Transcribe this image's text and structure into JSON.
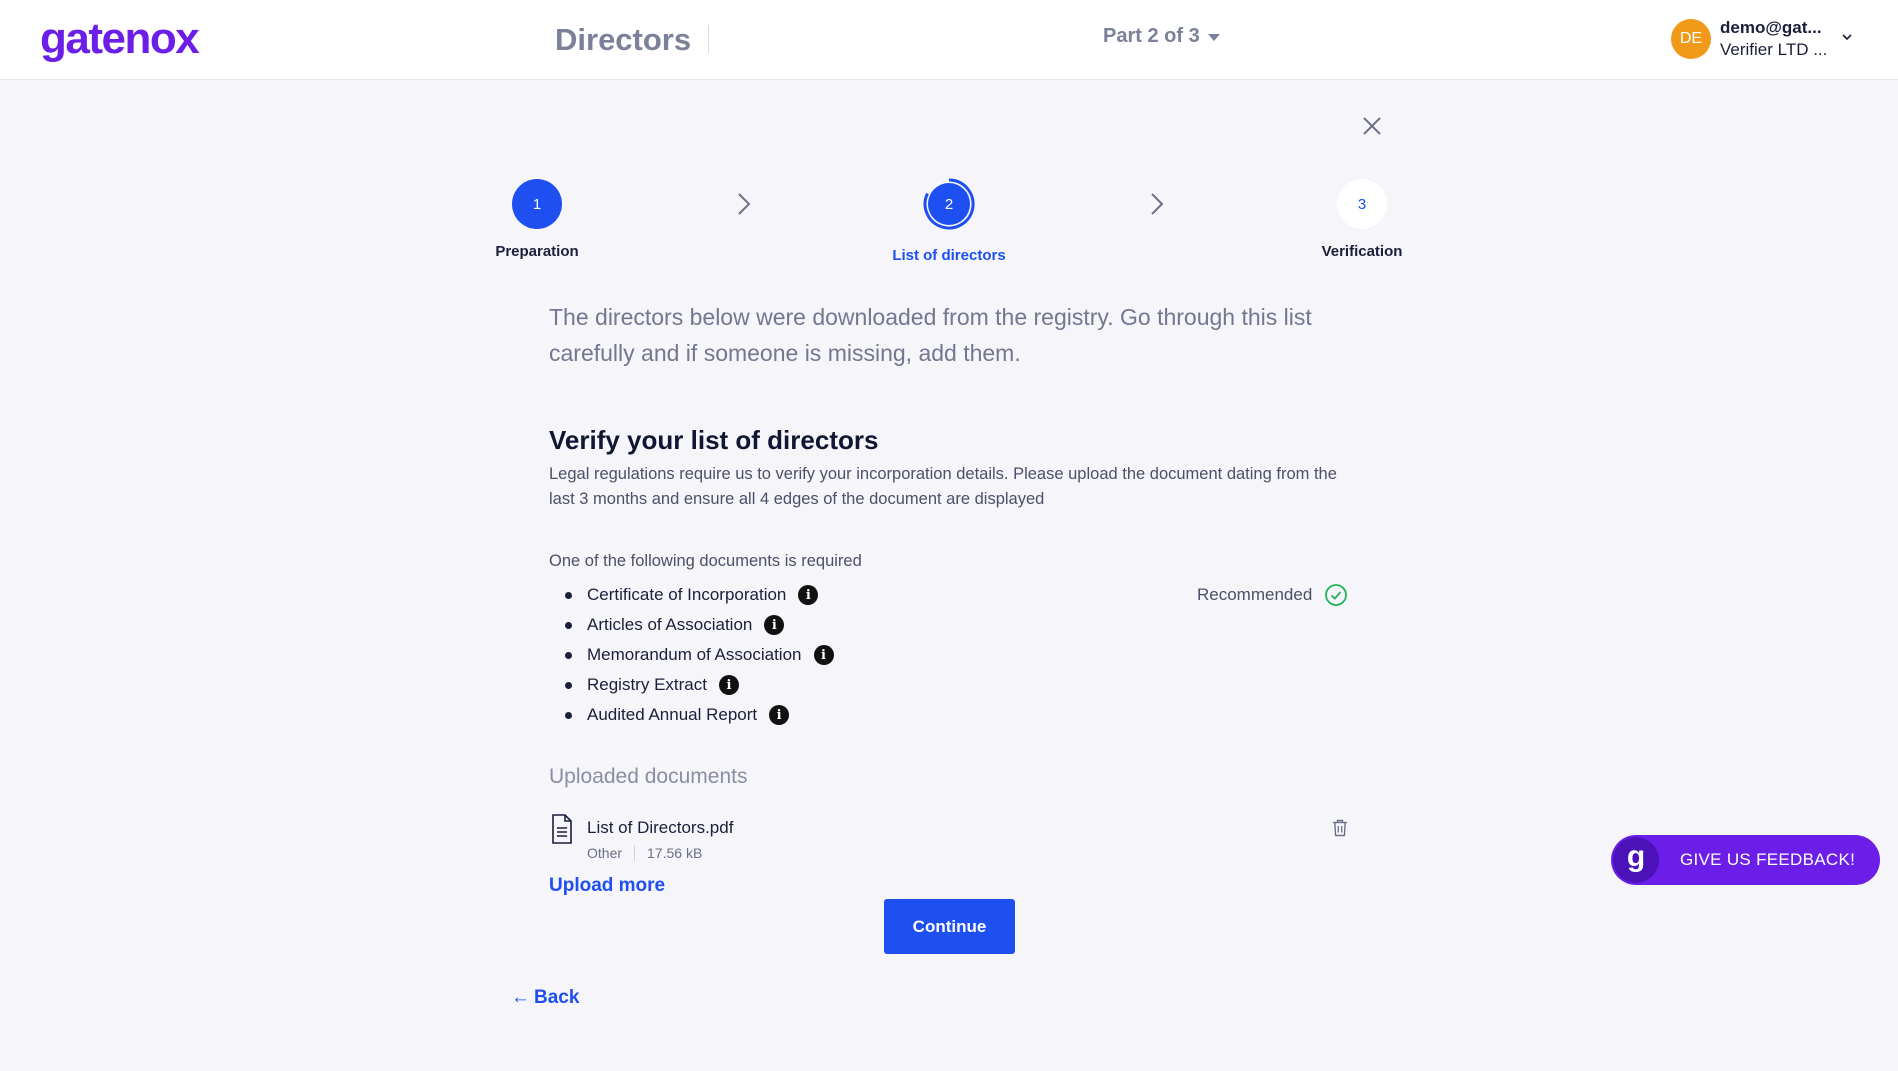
{
  "header": {
    "logo": "gatenox",
    "page_title": "Directors",
    "part_selector": "Part 2 of 3",
    "user": {
      "initials": "DE",
      "email": "demo@gat...",
      "company": "Verifier LTD ..."
    }
  },
  "stepper": {
    "steps": [
      {
        "number": "1",
        "label": "Preparation",
        "state": "completed"
      },
      {
        "number": "2",
        "label": "List of directors",
        "state": "current"
      },
      {
        "number": "3",
        "label": "Verification",
        "state": "upcoming"
      }
    ]
  },
  "intro_text": "The directors below were downloaded from the registry. Go through this list carefully and if someone is missing, add them.",
  "verify": {
    "title": "Verify your list of directors",
    "description": "Legal regulations require us to verify your incorporation details. Please upload the document dating from the last 3 months and ensure all 4 edges of the document are displayed",
    "required_label": "One of the following documents is required",
    "documents": [
      "Certificate of Incorporation",
      "Articles of Association",
      "Memorandum of Association",
      "Registry Extract",
      "Audited Annual Report"
    ],
    "recommended_label": "Recommended"
  },
  "uploaded": {
    "label": "Uploaded documents",
    "files": [
      {
        "name": "List of Directors.pdf",
        "type": "Other",
        "size": "17.56 kB"
      }
    ],
    "upload_more": "Upload more"
  },
  "actions": {
    "continue": "Continue",
    "back": "Back",
    "back_arrow": "←"
  },
  "feedback": {
    "logo": "g",
    "label": "GIVE US FEEDBACK!"
  },
  "colors": {
    "brand": "#6b1ee8",
    "primary": "#1e4ff0",
    "avatar": "#f19a1a",
    "success": "#22b35b"
  }
}
